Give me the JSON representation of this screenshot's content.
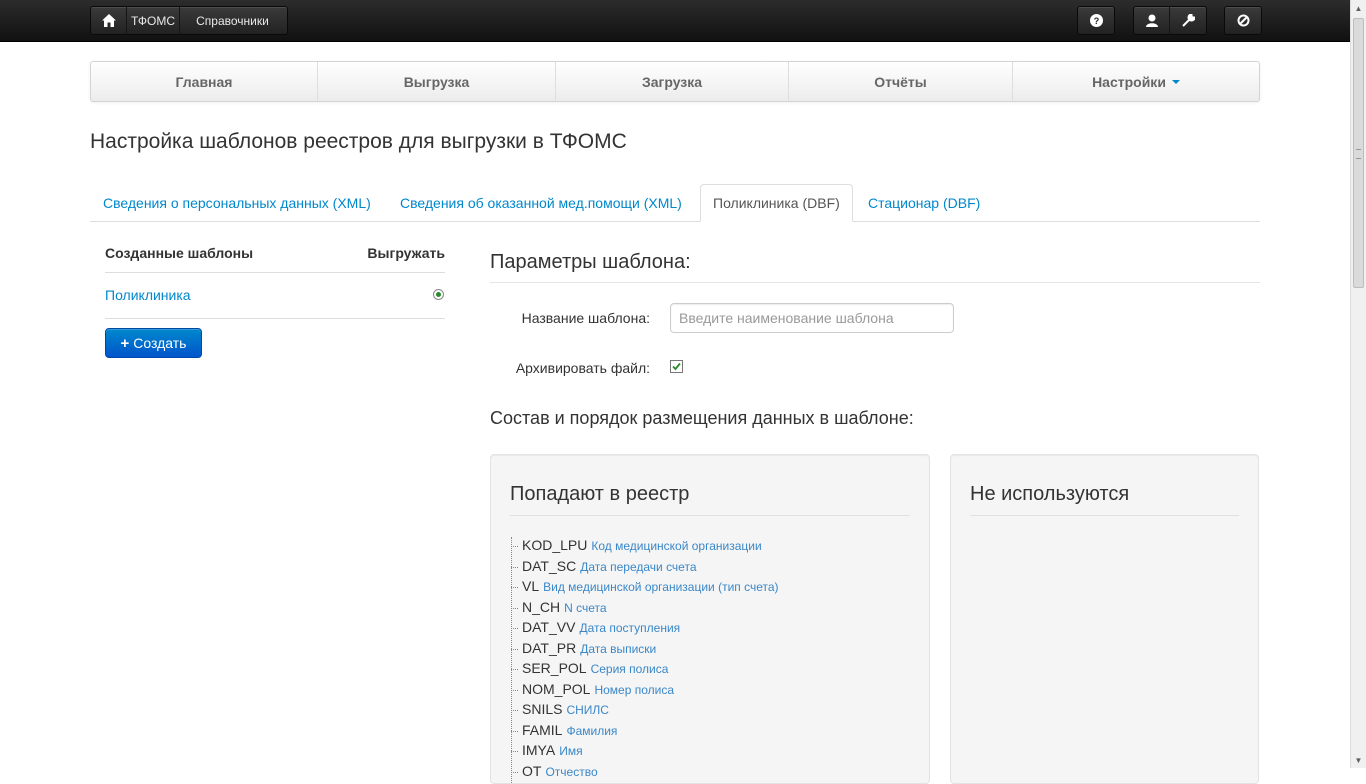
{
  "topbar": {
    "brand": "ТФОМС",
    "directories": "Справочники"
  },
  "mainnav": [
    {
      "label": "Главная"
    },
    {
      "label": "Выгрузка"
    },
    {
      "label": "Загрузка"
    },
    {
      "label": "Отчёты"
    },
    {
      "label": "Настройки"
    }
  ],
  "page_title": "Настройка шаблонов реестров для выгрузки в ТФОМС",
  "tabs": [
    {
      "label": "Сведения о персональных данных (XML)"
    },
    {
      "label": "Сведения об оказанной мед.помощи (XML)"
    },
    {
      "label": "Поликлиника (DBF)"
    },
    {
      "label": "Стационар (DBF)"
    }
  ],
  "left_panel": {
    "header_left": "Созданные шаблоны",
    "header_right": "Выгружать",
    "templates": [
      {
        "name": "Поликлиника",
        "selected": true
      }
    ],
    "create_label": "Создать"
  },
  "params": {
    "title": "Параметры шаблона:",
    "name_label": "Название шаблона:",
    "name_value": "",
    "name_placeholder": "Введите наименование шаблона",
    "archive_label": "Архивировать файл:",
    "archive_checked": true,
    "composition_title": "Состав и порядок размещения данных в шаблоне:"
  },
  "included": {
    "title": "Попадают в реестр",
    "fields": [
      {
        "code": "KOD_LPU",
        "desc": "Код медицинской организации"
      },
      {
        "code": "DAT_SC",
        "desc": "Дата передачи счета"
      },
      {
        "code": "VL",
        "desc": "Вид медицинской организации (тип счета)"
      },
      {
        "code": "N_CH",
        "desc": "N счета"
      },
      {
        "code": "DAT_VV",
        "desc": "Дата поступления"
      },
      {
        "code": "DAT_PR",
        "desc": "Дата выписки"
      },
      {
        "code": "SER_POL",
        "desc": "Серия полиса"
      },
      {
        "code": "NOM_POL",
        "desc": "Номер полиса"
      },
      {
        "code": "SNILS",
        "desc": "СНИЛС"
      },
      {
        "code": "FAMIL",
        "desc": "Фамилия"
      },
      {
        "code": "IMYA",
        "desc": "Имя"
      },
      {
        "code": "OT",
        "desc": "Отчество"
      }
    ]
  },
  "unused": {
    "title": "Не используются"
  },
  "colors": {
    "link": "#0088cc",
    "primary_btn": "#0055cc",
    "topbar": "#1b1b1b"
  }
}
